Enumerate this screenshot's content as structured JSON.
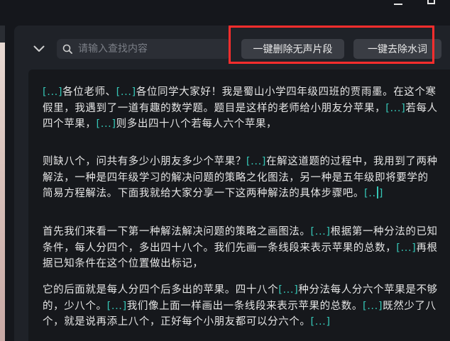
{
  "toolbar": {
    "search_placeholder": "请输入查找内容",
    "remove_silence_label": "一键删除无声片段",
    "remove_filler_label": "一键去除水词"
  },
  "transcript": {
    "marker": "[...]",
    "marker_partial_open": "[..",
    "marker_partial_close": "]",
    "p1": {
      "s1": "各位老师、",
      "s2": "各位同学大家好！我是蜀山小学四年级四班的贾雨墨。在这个寒假里，我遇到了一道有趣的数学题。题目是这样的老师给小朋友分苹果，",
      "s3": "若每人四个苹果，",
      "s4": "则多出四十八个若每人六个苹果，"
    },
    "p2": {
      "s1": "则缺八个，问共有多少小朋友多少个苹果？",
      "s2": "在解这道题的过程中，我用到了两种解法，一种是四年级学习的解决问题的策略之化图法，另一种是五年级即将要学的简易方程解法。下面我就给大家分享一下这两种解法的具体步骤吧。"
    },
    "p3": {
      "s1": "首先我们来看一下第一种解法解决问题的策略之画图法。",
      "s2": "根据第一种分法的已知条件，每人分四个，多出四十八个。我们先画一条线段来表示苹果的总数，",
      "s3": "再根据已知条件在这个位置做出标记，"
    },
    "p4": {
      "s1": "它的后面就是每人分四个后多出的苹果。四十八个",
      "s2": "种分法每人分六个苹果是不够的，少八个。",
      "s3": "我们像上面一样画出一条线段来表示苹果的总数。",
      "s4": "既然少了八个，就是说再添上八个，正好每个小朋友都可以分六个。"
    }
  },
  "colors": {
    "accent": "#35c6b6",
    "highlight": "#ff2d2d",
    "background": "#15171c",
    "button": "#3a3d44"
  },
  "icons": {
    "collapse": "chevron-down-icon",
    "search": "search-icon",
    "minimize": "minimize-icon",
    "maximize": "maximize-icon"
  }
}
